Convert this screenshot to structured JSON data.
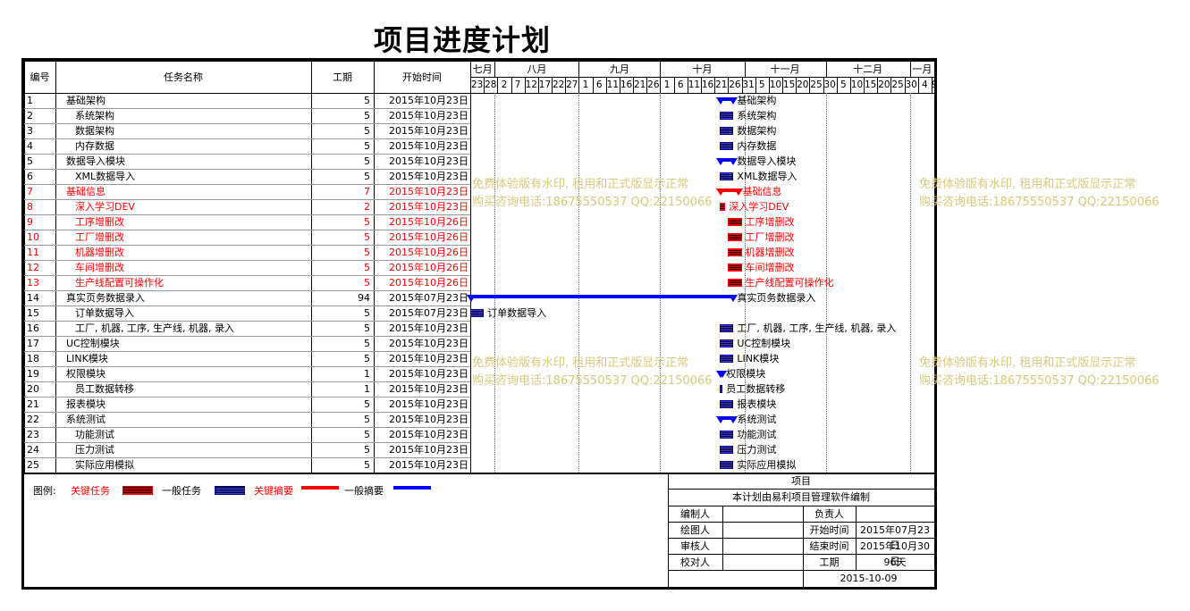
{
  "title": "项目进度计划",
  "columns": [
    "编号",
    "任务名称",
    "工期",
    "开始时间"
  ],
  "months": [
    "七月",
    "八月",
    "九月",
    "十月",
    "十一月",
    "十二月",
    "一月"
  ],
  "days": [
    "23",
    "28",
    "2",
    "7",
    "12",
    "17",
    "22",
    "27",
    "1",
    "6",
    "11",
    "16",
    "21",
    "26",
    "1",
    "6",
    "11",
    "16",
    "21",
    "26",
    "31",
    "5",
    "10",
    "15",
    "20",
    "25",
    "30",
    "5",
    "10",
    "15",
    "20",
    "25",
    "30",
    "4",
    "9"
  ],
  "tasks": [
    {
      "id": "1",
      "name": "基础架构",
      "dur": "5",
      "start": "2015年10月23日",
      "red": false,
      "indent": 0,
      "kind": "summary",
      "bar": {
        "from": "2015-10-23",
        "to": "2015-10-28"
      },
      "label": "基础架构"
    },
    {
      "id": "2",
      "name": "系统架构",
      "dur": "5",
      "start": "2015年10月23日",
      "red": false,
      "indent": 1,
      "kind": "task",
      "bar": {
        "from": "2015-10-23",
        "to": "2015-10-28"
      },
      "label": "系统架构"
    },
    {
      "id": "3",
      "name": "数据架构",
      "dur": "5",
      "start": "2015年10月23日",
      "red": false,
      "indent": 1,
      "kind": "task",
      "bar": {
        "from": "2015-10-23",
        "to": "2015-10-28"
      },
      "label": "数据架构"
    },
    {
      "id": "4",
      "name": "内存数据",
      "dur": "5",
      "start": "2015年10月23日",
      "red": false,
      "indent": 1,
      "kind": "task",
      "bar": {
        "from": "2015-10-23",
        "to": "2015-10-28"
      },
      "label": "内存数据"
    },
    {
      "id": "5",
      "name": "数据导入模块",
      "dur": "5",
      "start": "2015年10月23日",
      "red": false,
      "indent": 0,
      "kind": "summary",
      "bar": {
        "from": "2015-10-23",
        "to": "2015-10-28"
      },
      "label": "数据导入模块"
    },
    {
      "id": "6",
      "name": "XML数据导入",
      "dur": "5",
      "start": "2015年10月23日",
      "red": false,
      "indent": 1,
      "kind": "task",
      "bar": {
        "from": "2015-10-23",
        "to": "2015-10-28"
      },
      "label": "XML数据导入"
    },
    {
      "id": "7",
      "name": "基础信息",
      "dur": "7",
      "start": "2015年10月23日",
      "red": true,
      "indent": 0,
      "kind": "summary",
      "bar": {
        "from": "2015-10-23",
        "to": "2015-10-30"
      },
      "label": "基础信息"
    },
    {
      "id": "8",
      "name": "深入学习DEV",
      "dur": "2",
      "start": "2015年10月23日",
      "red": true,
      "indent": 1,
      "kind": "task",
      "bar": {
        "from": "2015-10-23",
        "to": "2015-10-25"
      },
      "label": "深入学习DEV"
    },
    {
      "id": "9",
      "name": "工序增删改",
      "dur": "5",
      "start": "2015年10月26日",
      "red": true,
      "indent": 1,
      "kind": "task",
      "bar": {
        "from": "2015-10-26",
        "to": "2015-10-31"
      },
      "label": "工序增删改"
    },
    {
      "id": "10",
      "name": "工厂增删改",
      "dur": "5",
      "start": "2015年10月26日",
      "red": true,
      "indent": 1,
      "kind": "task",
      "bar": {
        "from": "2015-10-26",
        "to": "2015-10-31"
      },
      "label": "工厂增删改"
    },
    {
      "id": "11",
      "name": "机器增删改",
      "dur": "5",
      "start": "2015年10月26日",
      "red": true,
      "indent": 1,
      "kind": "task",
      "bar": {
        "from": "2015-10-26",
        "to": "2015-10-31"
      },
      "label": "机器增删改"
    },
    {
      "id": "12",
      "name": "车间增删改",
      "dur": "5",
      "start": "2015年10月26日",
      "red": true,
      "indent": 1,
      "kind": "task",
      "bar": {
        "from": "2015-10-26",
        "to": "2015-10-31"
      },
      "label": "车间增删改"
    },
    {
      "id": "13",
      "name": "生产线配置可操作化",
      "dur": "5",
      "start": "2015年10月26日",
      "red": true,
      "indent": 1,
      "kind": "task",
      "bar": {
        "from": "2015-10-26",
        "to": "2015-10-31"
      },
      "label": "生产线配置可操作化"
    },
    {
      "id": "14",
      "name": "真实页务数据录入",
      "dur": "94",
      "start": "2015年07月23日",
      "red": false,
      "indent": 0,
      "kind": "summary",
      "bar": {
        "from": "2015-07-23",
        "to": "2015-10-28"
      },
      "label": "真实页务数据录入"
    },
    {
      "id": "15",
      "name": "订单数据导入",
      "dur": "5",
      "start": "2015年07月23日",
      "red": false,
      "indent": 1,
      "kind": "task",
      "bar": {
        "from": "2015-07-23",
        "to": "2015-07-28"
      },
      "label": "订单数据导入"
    },
    {
      "id": "16",
      "name": "工厂, 机器, 工序, 生产线, 机器, 录入",
      "dur": "5",
      "start": "2015年10月23日",
      "red": false,
      "indent": 1,
      "kind": "task",
      "bar": {
        "from": "2015-10-23",
        "to": "2015-10-28"
      },
      "label": "工厂, 机器, 工序, 生产线, 机器, 录入"
    },
    {
      "id": "17",
      "name": "UC控制模块",
      "dur": "5",
      "start": "2015年10月23日",
      "red": false,
      "indent": 0,
      "kind": "task",
      "bar": {
        "from": "2015-10-23",
        "to": "2015-10-28"
      },
      "label": "UC控制模块"
    },
    {
      "id": "18",
      "name": "LINK模块",
      "dur": "5",
      "start": "2015年10月23日",
      "red": false,
      "indent": 0,
      "kind": "task",
      "bar": {
        "from": "2015-10-23",
        "to": "2015-10-28"
      },
      "label": "LINK模块"
    },
    {
      "id": "19",
      "name": "权限模块",
      "dur": "1",
      "start": "2015年10月23日",
      "red": false,
      "indent": 0,
      "kind": "summary",
      "bar": {
        "from": "2015-10-23",
        "to": "2015-10-24"
      },
      "label": "权限模块"
    },
    {
      "id": "20",
      "name": "员工数据转移",
      "dur": "1",
      "start": "2015年10月23日",
      "red": false,
      "indent": 1,
      "kind": "task",
      "bar": {
        "from": "2015-10-23",
        "to": "2015-10-24"
      },
      "label": "员工数据转移"
    },
    {
      "id": "21",
      "name": "报表模块",
      "dur": "5",
      "start": "2015年10月23日",
      "red": false,
      "indent": 0,
      "kind": "task",
      "bar": {
        "from": "2015-10-23",
        "to": "2015-10-28"
      },
      "label": "报表模块"
    },
    {
      "id": "22",
      "name": "系统测试",
      "dur": "5",
      "start": "2015年10月23日",
      "red": false,
      "indent": 0,
      "kind": "summary",
      "bar": {
        "from": "2015-10-23",
        "to": "2015-10-28"
      },
      "label": "系统测试"
    },
    {
      "id": "23",
      "name": "功能测试",
      "dur": "5",
      "start": "2015年10月23日",
      "red": false,
      "indent": 1,
      "kind": "task",
      "bar": {
        "from": "2015-10-23",
        "to": "2015-10-28"
      },
      "label": "功能测试"
    },
    {
      "id": "24",
      "name": "压力测试",
      "dur": "5",
      "start": "2015年10月23日",
      "red": false,
      "indent": 1,
      "kind": "task",
      "bar": {
        "from": "2015-10-23",
        "to": "2015-10-28"
      },
      "label": "压力测试"
    },
    {
      "id": "25",
      "name": "实际应用模拟",
      "dur": "5",
      "start": "2015年10月23日",
      "red": false,
      "indent": 1,
      "kind": "task",
      "bar": {
        "from": "2015-10-23",
        "to": "2015-10-28"
      },
      "label": "实际应用模拟"
    }
  ],
  "timeline": {
    "start": "2015-07-23",
    "end": "2016-01-10"
  },
  "watermark": {
    "line1": "免费体验版有水印, 租用和正式版显示正常",
    "line2": "购买咨询电话:18675550537 QQ:22150066"
  },
  "legend": {
    "title": "图例:",
    "critical_task": "关键任务",
    "normal_task": "一般任务",
    "critical_summary": "关键摘要",
    "normal_summary": "一般摘要"
  },
  "info": {
    "project_label": "项目",
    "made_by": "本计划由易利项目管理软件编制",
    "editor_label": "编制人",
    "owner_label": "负责人",
    "drawer_label": "绘图人",
    "start_label": "开始时间",
    "start_value": "2015年07月23日",
    "reviewer_label": "审核人",
    "end_label": "结束时间",
    "end_value": "2015年10月30日",
    "checker_label": "校对人",
    "duration_label": "工期",
    "duration_value": "96天",
    "date": "2015-10-09"
  },
  "colors": {
    "red": "#ff0000",
    "blue": "#0000ff",
    "navy": "#000080",
    "watermark": "#d8c87a"
  }
}
